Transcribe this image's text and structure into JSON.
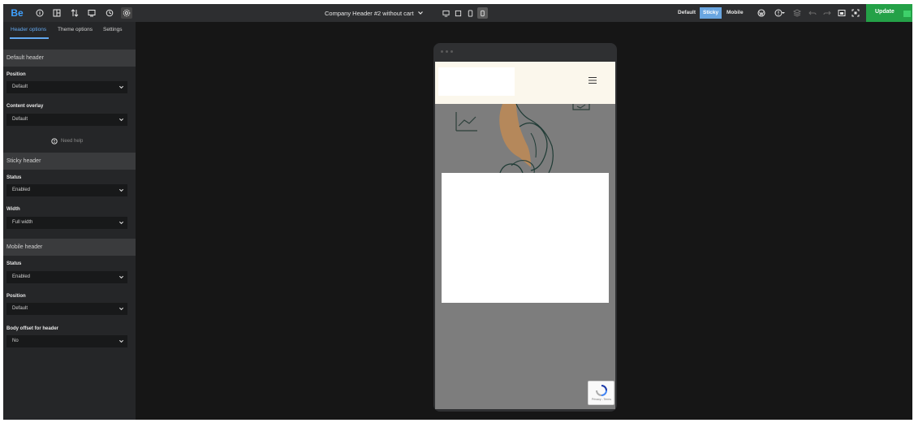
{
  "topbar": {
    "logo": "Be",
    "template_name": "Company Header #2 without cart",
    "modes": [
      "Default",
      "Sticky",
      "Mobile"
    ],
    "active_mode": "Sticky",
    "update_label": "Update",
    "accent_color": "#24a147",
    "icons": [
      "info-icon",
      "layout-icon",
      "sort-icon",
      "preview-icon",
      "history-icon",
      "settings-icon"
    ],
    "device_icons": [
      "desktop-icon",
      "laptop-icon",
      "tablet-icon",
      "mobile-icon"
    ],
    "right_icons": [
      "wordpress-icon",
      "help-icon",
      "layers-icon",
      "undo-icon",
      "redo-icon",
      "preview-window-icon",
      "fullscreen-icon"
    ]
  },
  "panel": {
    "tabs": [
      "Header options",
      "Theme options",
      "Settings"
    ],
    "active_tab": "Header options",
    "sections": {
      "default_header": {
        "title": "Default header",
        "position_label": "Position",
        "position_value": "Default",
        "overlay_label": "Content overlay",
        "overlay_value": "Default",
        "help_label": "Need help"
      },
      "sticky_header": {
        "title": "Sticky header",
        "status_label": "Status",
        "status_value": "Enabled",
        "width_label": "Width",
        "width_value": "Full width"
      },
      "mobile_header": {
        "title": "Mobile header",
        "status_label": "Status",
        "status_value": "Enabled",
        "position_label": "Position",
        "position_value": "Default",
        "offset_label": "Body offset for header",
        "offset_value": "No"
      }
    }
  },
  "preview": {
    "header_bg": "#fbf7ec",
    "recaptcha_terms": "Privacy - Terms"
  }
}
